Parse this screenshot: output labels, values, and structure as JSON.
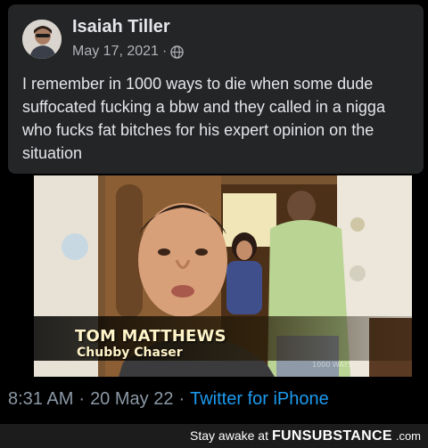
{
  "post": {
    "author": "Isaiah Tiller",
    "date": "May 17, 2021",
    "separator": "·",
    "privacy_icon": "globe-icon",
    "text": "I remember in 1000 ways to die when some dude suffocated fucking a bbw and they called in a nigga who fucks fat bitches for his expert opinion on the situation"
  },
  "video": {
    "name": "TOM MATTHEWS",
    "title": "Chubby Chaser",
    "watermark": "1000 WAYS"
  },
  "tweet": {
    "time": "8:31 AM",
    "sep1": "·",
    "date": "20 May 22",
    "sep2": "·",
    "app": "Twitter for iPhone"
  },
  "branding": {
    "prefix": "Stay awake at",
    "logo": "FUNSUBSTANCE",
    "domain": ".com"
  },
  "colors": {
    "card_bg": "#242526",
    "text": "#e4e6eb",
    "muted": "#b0b3b8",
    "link": "#1d9bf0"
  }
}
